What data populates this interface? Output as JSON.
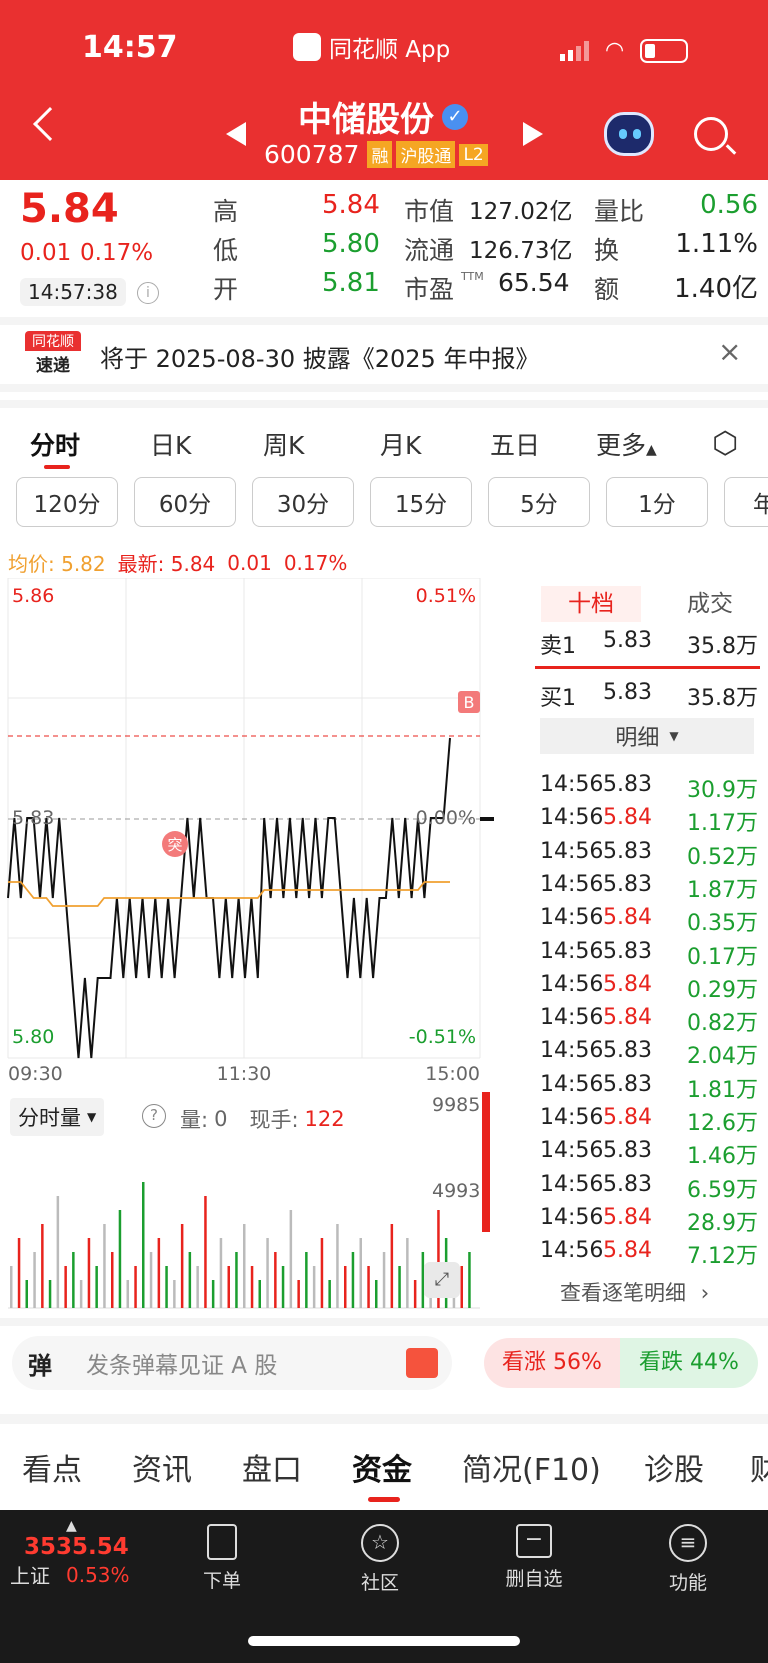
{
  "status_bar": {
    "time": "14:57",
    "app": "同花顺 App"
  },
  "header": {
    "name": "中储股份",
    "code": "600787",
    "tags": [
      "融",
      "沪股通",
      "L2"
    ]
  },
  "quote": {
    "price": "5.84",
    "change": "0.01",
    "change_pct": "0.17%",
    "time": "14:57:38",
    "high_label": "高",
    "high": "5.84",
    "low_label": "低",
    "low": "5.80",
    "open_label": "开",
    "open": "5.81",
    "mcap_label": "市值",
    "mcap": "127.02亿",
    "float_label": "流通",
    "float": "126.73亿",
    "pe_label": "市盈",
    "pe_sup": "TTM",
    "pe": "65.54",
    "vr_label": "量比",
    "vr": "0.56",
    "turnover_label": "换",
    "turnover": "1.11%",
    "amount_label": "额",
    "amount": "1.40亿"
  },
  "news": {
    "logo_line1": "同花顺",
    "logo_line2": "速递",
    "text": "将于 2025-08-30 披露《2025 年中报》"
  },
  "chart_tabs": [
    "分时",
    "日K",
    "周K",
    "月K",
    "五日",
    "更多"
  ],
  "period_pills": [
    "120分",
    "60分",
    "30分",
    "15分",
    "5分",
    "1分",
    "年"
  ],
  "chart_info": {
    "avg_label": "均价: 5.82",
    "latest_label": "最新: 5.84",
    "chg": "0.01",
    "pct": "0.17%"
  },
  "chart_data": {
    "type": "line",
    "y_left_ticks": [
      "5.86",
      "5.83",
      "5.80"
    ],
    "y_right_ticks": [
      "0.51%",
      "0.00%",
      "-0.51%"
    ],
    "x_ticks": [
      "09:30",
      "11:30",
      "15:00"
    ],
    "ylim": [
      5.8,
      5.86
    ],
    "prev_close": 5.83,
    "series": [
      {
        "color": "#111111",
        "values": [
          5.82,
          5.83,
          5.82,
          5.83,
          5.83,
          5.82,
          5.83,
          5.82,
          5.83,
          5.82,
          5.81,
          5.8,
          5.81,
          5.8,
          5.81,
          5.81,
          5.81,
          5.82,
          5.81,
          5.82,
          5.81,
          5.82,
          5.81,
          5.82,
          5.81,
          5.82,
          5.81,
          5.82,
          5.83,
          5.82,
          5.83,
          5.82,
          5.82,
          5.81,
          5.82,
          5.81,
          5.82,
          5.81,
          5.82,
          5.81,
          5.83,
          5.82,
          5.83,
          5.82,
          5.83,
          5.82,
          5.83,
          5.82,
          5.83,
          5.82,
          5.83,
          5.83,
          5.82,
          5.81,
          5.82,
          5.81,
          5.82,
          5.81,
          5.82,
          5.82,
          5.83,
          5.82,
          5.83,
          5.82,
          5.83,
          5.82,
          5.83,
          5.83,
          5.83,
          5.84
        ]
      },
      {
        "color": "#f0a030",
        "values": [
          5.822,
          5.822,
          5.822,
          5.821,
          5.82,
          5.82,
          5.82,
          5.819,
          5.819,
          5.819,
          5.819,
          5.819,
          5.819,
          5.819,
          5.819,
          5.82,
          5.82,
          5.82,
          5.82,
          5.82,
          5.82,
          5.82,
          5.82,
          5.82,
          5.82,
          5.82,
          5.82,
          5.82,
          5.82,
          5.82,
          5.82,
          5.82,
          5.82,
          5.82,
          5.82,
          5.82,
          5.82,
          5.82,
          5.82,
          5.82,
          5.821,
          5.821,
          5.821,
          5.821,
          5.821,
          5.821,
          5.821,
          5.821,
          5.821,
          5.821,
          5.821,
          5.821,
          5.821,
          5.821,
          5.821,
          5.821,
          5.821,
          5.821,
          5.821,
          5.821,
          5.821,
          5.821,
          5.821,
          5.821,
          5.821,
          5.822,
          5.822,
          5.822,
          5.822,
          5.822
        ]
      }
    ],
    "markers": [
      "B",
      "突"
    ]
  },
  "volume_panel": {
    "selector": "分时量",
    "vol_label": "量:",
    "vol": "0",
    "hand_label": "现手:",
    "hand": "122",
    "max": "9985",
    "mid": "4993",
    "bars": [
      3,
      5,
      2,
      4,
      6,
      2,
      8,
      3,
      4,
      2,
      5,
      3,
      6,
      4,
      7,
      2,
      3,
      9,
      4,
      5,
      3,
      2,
      6,
      4,
      3,
      8,
      2,
      5,
      3,
      4,
      6,
      3,
      2,
      5,
      4,
      3,
      7,
      2,
      4,
      3,
      5,
      2,
      6,
      3,
      4,
      5,
      3,
      2,
      4,
      6,
      3,
      5,
      2,
      4,
      3,
      7,
      5,
      2,
      3,
      4
    ]
  },
  "order_book": {
    "tab_active": "十档",
    "tab_other": "成交",
    "sell1_label": "卖1",
    "sell1_price": "5.83",
    "sell1_vol": "35.8万",
    "buy1_label": "买1",
    "buy1_price": "5.83",
    "buy1_vol": "35.8万",
    "detail_label": "明细",
    "trades": [
      {
        "t": "14:56",
        "p": "5.83",
        "v": "30.9万",
        "c": "green"
      },
      {
        "t": "14:56",
        "p": "5.84",
        "v": "1.17万",
        "c": "red"
      },
      {
        "t": "14:56",
        "p": "5.83",
        "v": "0.52万",
        "c": "green"
      },
      {
        "t": "14:56",
        "p": "5.83",
        "v": "1.87万",
        "c": "green"
      },
      {
        "t": "14:56",
        "p": "5.84",
        "v": "0.35万",
        "c": "red"
      },
      {
        "t": "14:56",
        "p": "5.83",
        "v": "0.17万",
        "c": "green"
      },
      {
        "t": "14:56",
        "p": "5.84",
        "v": "0.29万",
        "c": "red"
      },
      {
        "t": "14:56",
        "p": "5.84",
        "v": "0.82万",
        "c": "red"
      },
      {
        "t": "14:56",
        "p": "5.83",
        "v": "2.04万",
        "c": "green"
      },
      {
        "t": "14:56",
        "p": "5.83",
        "v": "1.81万",
        "c": "green"
      },
      {
        "t": "14:56",
        "p": "5.84",
        "v": "12.6万",
        "c": "red"
      },
      {
        "t": "14:56",
        "p": "5.83",
        "v": "1.46万",
        "c": "green"
      },
      {
        "t": "14:56",
        "p": "5.83",
        "v": "6.59万",
        "c": "green"
      },
      {
        "t": "14:56",
        "p": "5.84",
        "v": "28.9万",
        "c": "red"
      },
      {
        "t": "14:56",
        "p": "5.84",
        "v": "7.12万",
        "c": "red"
      }
    ],
    "more_label": "查看逐笔明细"
  },
  "barrage": {
    "icon": "弹",
    "placeholder": "发条弹幕见证 A 股",
    "up": "看涨 56%",
    "down": "看跌 44%"
  },
  "bottom_tabs": [
    "看点",
    "资讯",
    "盘口",
    "资金",
    "简况(F10)",
    "诊股",
    "财"
  ],
  "nav": {
    "index_value": "3535.54",
    "index_name": "上证",
    "index_pct": "0.53%",
    "items": [
      "下单",
      "社区",
      "删自选",
      "功能"
    ]
  }
}
